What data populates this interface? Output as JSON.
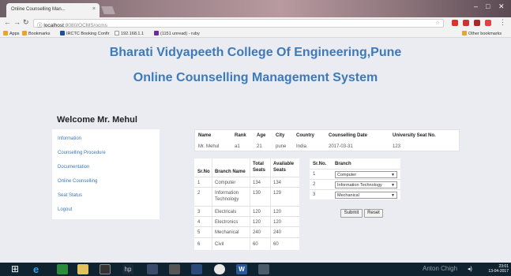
{
  "browser": {
    "tab_title": "Online Counselling Man...",
    "tab_close": "×",
    "url_host": "localhost",
    "url_path": ":8080/OCMS/ocms",
    "bookmarks": [
      {
        "label": "Apps",
        "color": "#e9a331"
      },
      {
        "label": "Bookmarks",
        "color": "#e9a331"
      },
      {
        "label": "IRCTC Booking Confir",
        "color": "#1f4f9a"
      },
      {
        "label": "192.168.1.1",
        "color": "#9a9a9a"
      },
      {
        "label": "(1151 unread) - ruby",
        "color": "#6a2aa0"
      }
    ],
    "other_bookmarks": "Other bookmarks"
  },
  "page": {
    "college": "Bharati Vidyapeeth College Of Engineering,Pune",
    "system": "Online Counselling Management System",
    "welcome": "Welcome Mr. Mehul"
  },
  "menu": [
    "Information",
    "Counselling Procedure",
    "Documentation",
    "Online Counselling",
    "Seat Status",
    "Logout"
  ],
  "student": {
    "headers": [
      "Name",
      "Rank",
      "Age",
      "City",
      "Country",
      "Counselling Date",
      "University Seat No."
    ],
    "values": [
      "Mr. Mehul",
      "a1",
      "21",
      "pune",
      "India",
      "2017-03-31",
      "123"
    ]
  },
  "branches": {
    "headers": [
      "Sr.No",
      "Branch Name",
      "Total Seats",
      "Available Seats"
    ],
    "rows": [
      [
        "1",
        "Computer",
        "134",
        "134"
      ],
      [
        "2",
        "Information Technology",
        "130",
        "129"
      ],
      [
        "3",
        "Electricals",
        "120",
        "120"
      ],
      [
        "4",
        "Electronics",
        "120",
        "120"
      ],
      [
        "5",
        "Mechanical",
        "240",
        "240"
      ],
      [
        "6",
        "Civil",
        "60",
        "60"
      ]
    ]
  },
  "preferences": {
    "headers": [
      "Sr.No.",
      "Branch"
    ],
    "rows": [
      {
        "no": "1",
        "branch": "Computer"
      },
      {
        "no": "2",
        "branch": "Information Technology"
      },
      {
        "no": "3",
        "branch": "Mechanical"
      }
    ],
    "submit_label": "Submit",
    "reset_label": "Reset"
  },
  "taskbar": {
    "user_overlay": "Anton Chigh",
    "time": "23:01",
    "date": "13-04-2017"
  },
  "colors": {
    "heading": "#3d7ab8",
    "link": "#3a78b5",
    "taskbar": "#0f2230"
  }
}
